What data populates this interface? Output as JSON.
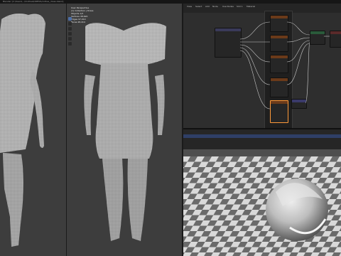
{
  "window": {
    "title": "Blender [C:\\Users\\...\\Clothes\\DRESS\\clothes_dress.blend]"
  },
  "viewport_center": {
    "hud_lines": [
      "User Perspective",
      "(1) Collection | Dress",
      "Objects 1/2",
      "Vertices 48,620",
      "Edges 97,010",
      "Faces 48,414"
    ]
  },
  "node_editor": {
    "menu": [
      "View",
      "Select",
      "Add",
      "Node",
      "Use Nodes",
      "Slot 1",
      "Material"
    ]
  },
  "colors": {
    "accent_orange": "#ff9a3a",
    "accent_blue": "#4d6fa8",
    "panel": "#2e2e2e",
    "viewport": "#3d3d3d"
  },
  "icons": [
    "move-icon",
    "rotate-icon",
    "scale-icon",
    "transform-icon",
    "annotate-icon",
    "measure-icon"
  ]
}
